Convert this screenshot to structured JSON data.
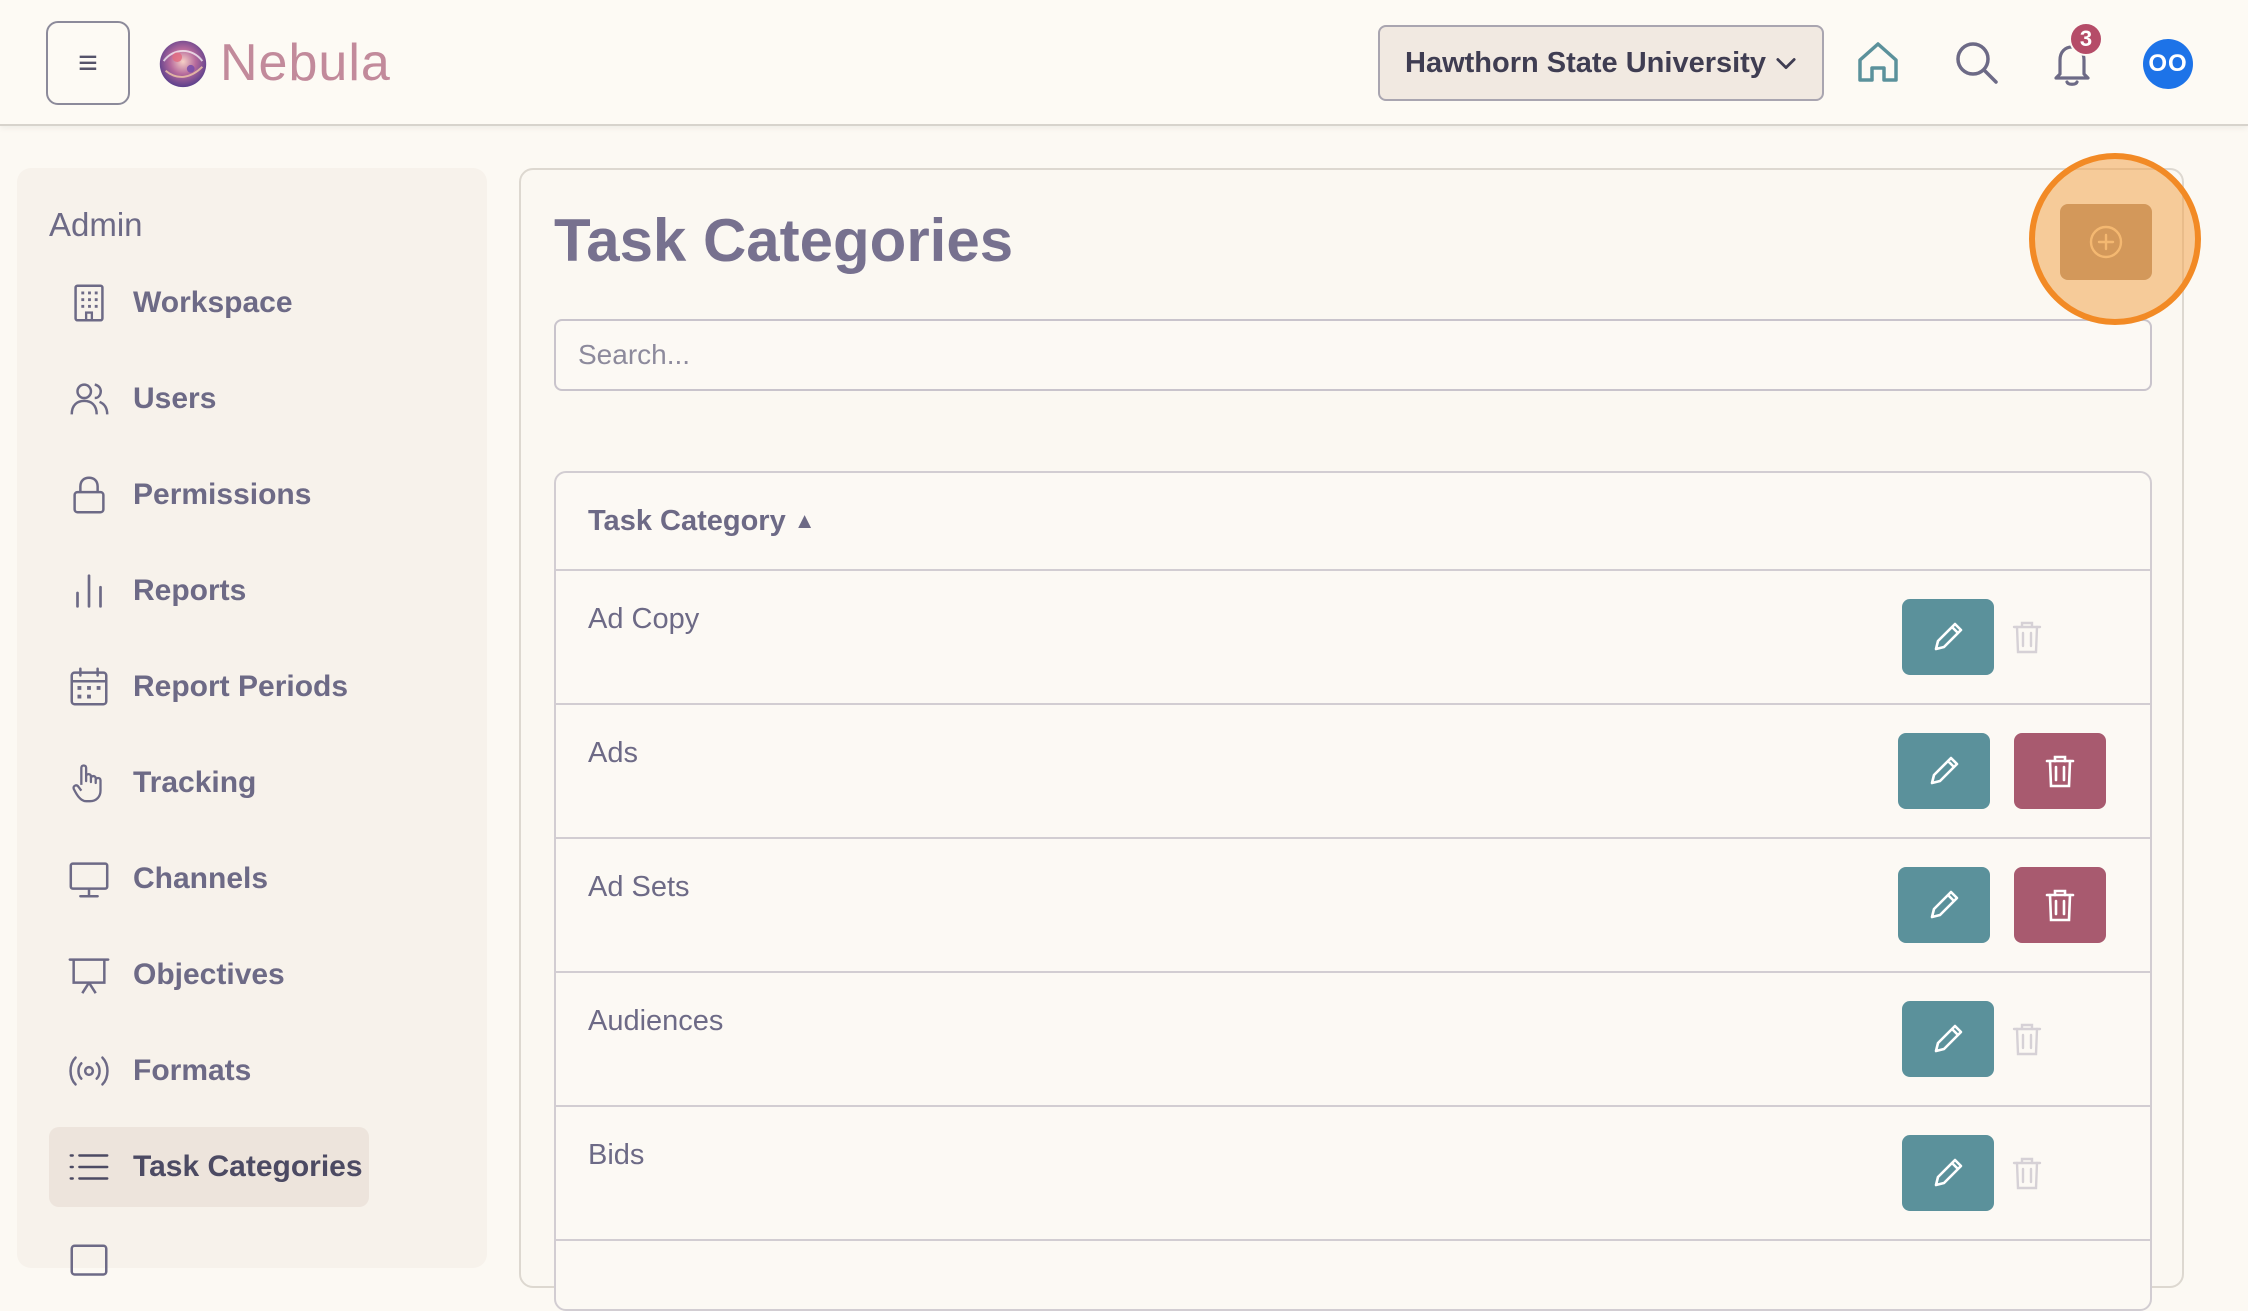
{
  "header": {
    "menu_glyph": "≡",
    "logo_text": "Nebula",
    "org_select": "Hawthorn State University",
    "notification_count": "3",
    "avatar_initials": "OO"
  },
  "sidebar": {
    "title": "Admin",
    "items": [
      {
        "label": "Workspace",
        "icon": "building-icon"
      },
      {
        "label": "Users",
        "icon": "users-icon"
      },
      {
        "label": "Permissions",
        "icon": "lock-icon"
      },
      {
        "label": "Reports",
        "icon": "bar-chart-icon"
      },
      {
        "label": "Report Periods",
        "icon": "calendar-icon"
      },
      {
        "label": "Tracking",
        "icon": "pointer-hand-icon"
      },
      {
        "label": "Channels",
        "icon": "monitor-icon"
      },
      {
        "label": "Objectives",
        "icon": "presentation-icon"
      },
      {
        "label": "Formats",
        "icon": "broadcast-icon"
      },
      {
        "label": "Task Categories",
        "icon": "list-icon",
        "active": true
      }
    ]
  },
  "main": {
    "title": "Task Categories",
    "search_placeholder": "Search...",
    "table": {
      "column": "Task Category",
      "sort_glyph": "▲",
      "rows": [
        {
          "name": "Ad Copy",
          "deletable": false
        },
        {
          "name": "Ads",
          "deletable": true
        },
        {
          "name": "Ad Sets",
          "deletable": true
        },
        {
          "name": "Audiences",
          "deletable": false
        },
        {
          "name": "Bids",
          "deletable": false
        }
      ]
    }
  },
  "colors": {
    "edit": "#5b919b",
    "delete": "#a85a6f",
    "add": "#ad8866",
    "highlight": "#f28a25"
  }
}
